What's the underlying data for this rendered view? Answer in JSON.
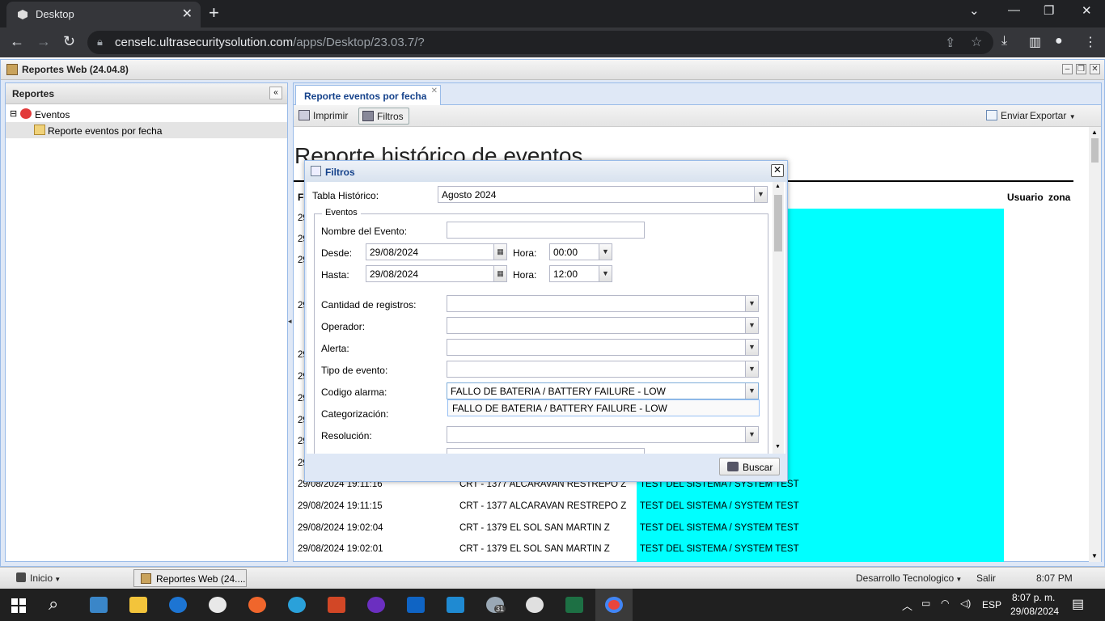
{
  "browser": {
    "tab_title": "Desktop",
    "url_domain": "censelc.ultrasecuritysolution.com",
    "url_path": "/apps/Desktop/23.03.7/?"
  },
  "app": {
    "title": "Reportes Web (24.04.8)",
    "left_panel": {
      "title": "Reportes",
      "tree": [
        {
          "label": "Eventos",
          "expander": "⊟"
        },
        {
          "label": "Reporte eventos por fecha"
        }
      ]
    },
    "main_tab": "Reporte eventos por fecha",
    "toolbar": {
      "imprimir": "Imprimir",
      "filtros": "Filtros",
      "enviar": "Enviar",
      "exportar": "Exportar"
    },
    "report_title": "Reporte histórico de eventos",
    "columns": {
      "first": "F",
      "usuario": "Usuario",
      "zona": "zona"
    },
    "row_prefix": [
      "29",
      "29",
      "29",
      "29",
      "29",
      "29",
      "29",
      "29",
      "29",
      "29",
      "29",
      "29"
    ],
    "rows": [
      {
        "date": "29/08/2024 19:11:16",
        "account": "CRT - 1377 ALCARAVAN RESTREPO Z",
        "event": "TEST DEL SISTEMA / SYSTEM TEST"
      },
      {
        "date": "29/08/2024 19:11:15",
        "account": "CRT - 1377 ALCARAVAN RESTREPO Z",
        "event": "TEST DEL SISTEMA / SYSTEM TEST"
      },
      {
        "date": "29/08/2024 19:02:04",
        "account": "CRT - 1379 EL SOL SAN MARTIN Z",
        "event": "TEST DEL SISTEMA / SYSTEM TEST"
      },
      {
        "date": "29/08/2024 19:02:01",
        "account": "CRT - 1379 EL SOL SAN MARTIN Z",
        "event": "TEST DEL SISTEMA / SYSTEM TEST"
      }
    ]
  },
  "dialog": {
    "title": "Filtros",
    "tabla_label": "Tabla Histórico:",
    "tabla_value": "Agosto 2024",
    "fieldset_legend": "Eventos",
    "nombre_label": "Nombre del Evento:",
    "nombre_value": "",
    "desde_label": "Desde:",
    "desde_value": "29/08/2024",
    "hora_label": "Hora:",
    "desde_hora": "00:00",
    "hasta_label": "Hasta:",
    "hasta_value": "29/08/2024",
    "hasta_hora": "12:00",
    "cantidad_label": "Cantidad de registros:",
    "operador_label": "Operador:",
    "alerta_label": "Alerta:",
    "tipo_label": "Tipo de evento:",
    "codigo_label": "Codigo alarma:",
    "codigo_value": "FALLO DE BATERIA / BATTERY FAILURE - LOW",
    "codigo_option": "FALLO DE BATERIA / BATTERY FAILURE - LOW",
    "categorizacion_label": "Categorización:",
    "resolucion_label": "Resolución:",
    "buscar": "Buscar"
  },
  "appbar": {
    "inicio": "Inicio",
    "task": "Reportes Web (24....",
    "user": "Desarrollo Tecnologico",
    "salir": "Salir",
    "time": "8:07 PM"
  },
  "taskbar": {
    "lang": "ESP",
    "time": "8:07 p. m.",
    "date": "29/08/2024",
    "badge": "31"
  }
}
